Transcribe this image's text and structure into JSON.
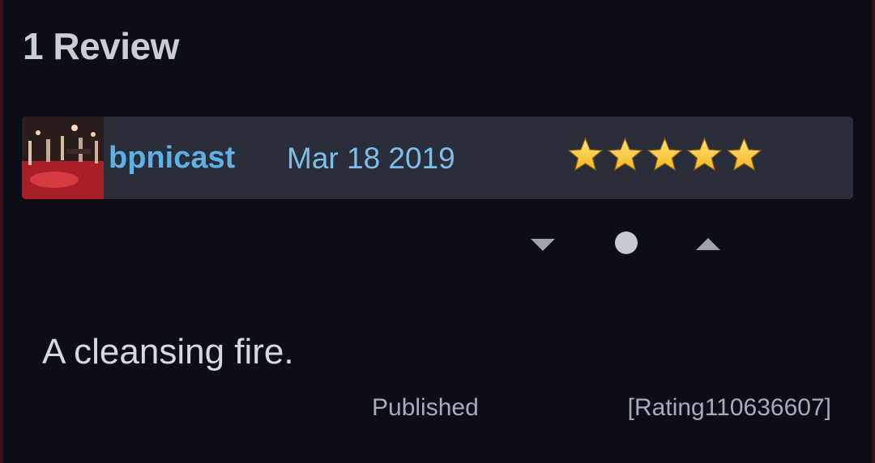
{
  "section": {
    "heading": "1 Review"
  },
  "review": {
    "username": "bpnicast",
    "date": "Mar 18 2019",
    "rating_stars": 5,
    "rating_max": 5,
    "star_color": "#f5b820",
    "avatar_icon": "concert-photo",
    "text": "A cleansing fire.",
    "status": "Published",
    "rating_id": "[Rating110636607]"
  },
  "votes": {
    "down_icon": "triangle-down-icon",
    "neutral_icon": "circle-icon",
    "up_icon": "triangle-up-icon"
  },
  "colors": {
    "background": "#0c0d16",
    "header_bar": "#2a2e3b",
    "username": "#5db1e6",
    "date": "#7fbde8"
  }
}
